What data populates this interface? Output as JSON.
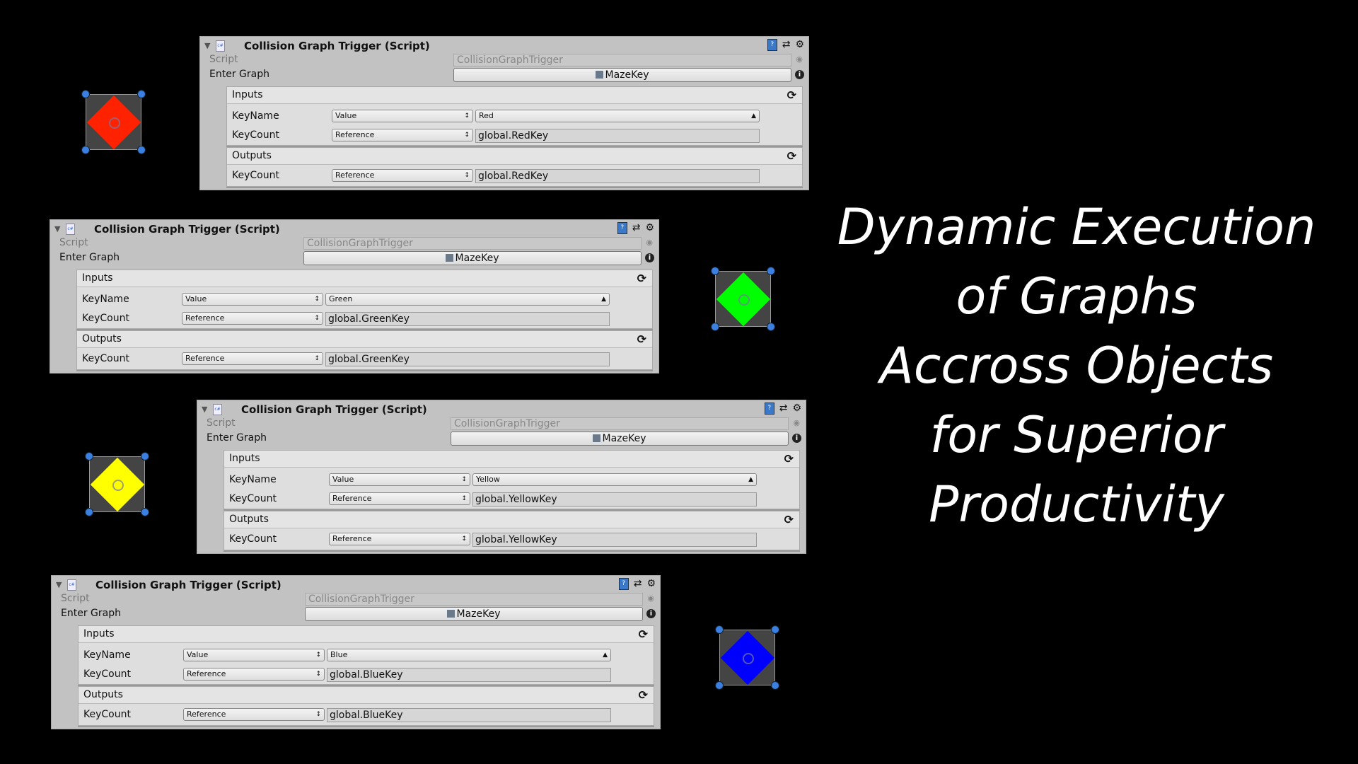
{
  "headline": [
    "Dynamic Execution",
    "of Graphs",
    "Accross Objects",
    "for Superior",
    "Productivity"
  ],
  "panels": [
    {
      "title": "Collision Graph Trigger (Script)",
      "script_label": "Script",
      "script_value": "CollisionGraphTrigger",
      "enter_graph_label": "Enter Graph",
      "enter_graph_value": "MazeKey",
      "inputs_label": "Inputs",
      "outputs_label": "Outputs",
      "inputs": [
        {
          "name": "KeyName",
          "mode": "Value",
          "value": "Red",
          "value_is_dropdown": true
        },
        {
          "name": "KeyCount",
          "mode": "Reference",
          "value": "global.RedKey"
        }
      ],
      "outputs": [
        {
          "name": "KeyCount",
          "mode": "Reference",
          "value": "global.RedKey"
        }
      ]
    },
    {
      "title": "Collision Graph Trigger (Script)",
      "script_label": "Script",
      "script_value": "CollisionGraphTrigger",
      "enter_graph_label": "Enter Graph",
      "enter_graph_value": "MazeKey",
      "inputs_label": "Inputs",
      "outputs_label": "Outputs",
      "inputs": [
        {
          "name": "KeyName",
          "mode": "Value",
          "value": "Green",
          "value_is_dropdown": true
        },
        {
          "name": "KeyCount",
          "mode": "Reference",
          "value": "global.GreenKey"
        }
      ],
      "outputs": [
        {
          "name": "KeyCount",
          "mode": "Reference",
          "value": "global.GreenKey"
        }
      ]
    },
    {
      "title": "Collision Graph Trigger (Script)",
      "script_label": "Script",
      "script_value": "CollisionGraphTrigger",
      "enter_graph_label": "Enter Graph",
      "enter_graph_value": "MazeKey",
      "inputs_label": "Inputs",
      "outputs_label": "Outputs",
      "inputs": [
        {
          "name": "KeyName",
          "mode": "Value",
          "value": "Yellow",
          "value_is_dropdown": true
        },
        {
          "name": "KeyCount",
          "mode": "Reference",
          "value": "global.YellowKey"
        }
      ],
      "outputs": [
        {
          "name": "KeyCount",
          "mode": "Reference",
          "value": "global.YellowKey"
        }
      ]
    },
    {
      "title": "Collision Graph Trigger (Script)",
      "script_label": "Script",
      "script_value": "CollisionGraphTrigger",
      "enter_graph_label": "Enter Graph",
      "enter_graph_value": "MazeKey",
      "inputs_label": "Inputs",
      "outputs_label": "Outputs",
      "inputs": [
        {
          "name": "KeyName",
          "mode": "Value",
          "value": "Blue",
          "value_is_dropdown": true
        },
        {
          "name": "KeyCount",
          "mode": "Reference",
          "value": "global.BlueKey"
        }
      ],
      "outputs": [
        {
          "name": "KeyCount",
          "mode": "Reference",
          "value": "global.BlueKey"
        }
      ]
    }
  ],
  "key_objects": [
    {
      "color_name": "red",
      "color": "#ff2200"
    },
    {
      "color_name": "green",
      "color": "#00ff00"
    },
    {
      "color_name": "yellow",
      "color": "#ffff00"
    },
    {
      "color_name": "blue",
      "color": "#0000ff"
    }
  ],
  "icons": {
    "foldout": "triangle-down",
    "script": "csharp-script-icon",
    "help": "help-book-icon",
    "preset": "preset-icon",
    "settings": "gear-icon",
    "refresh": "refresh-icon",
    "info": "info-icon",
    "object_picker": "object-picker-icon"
  }
}
